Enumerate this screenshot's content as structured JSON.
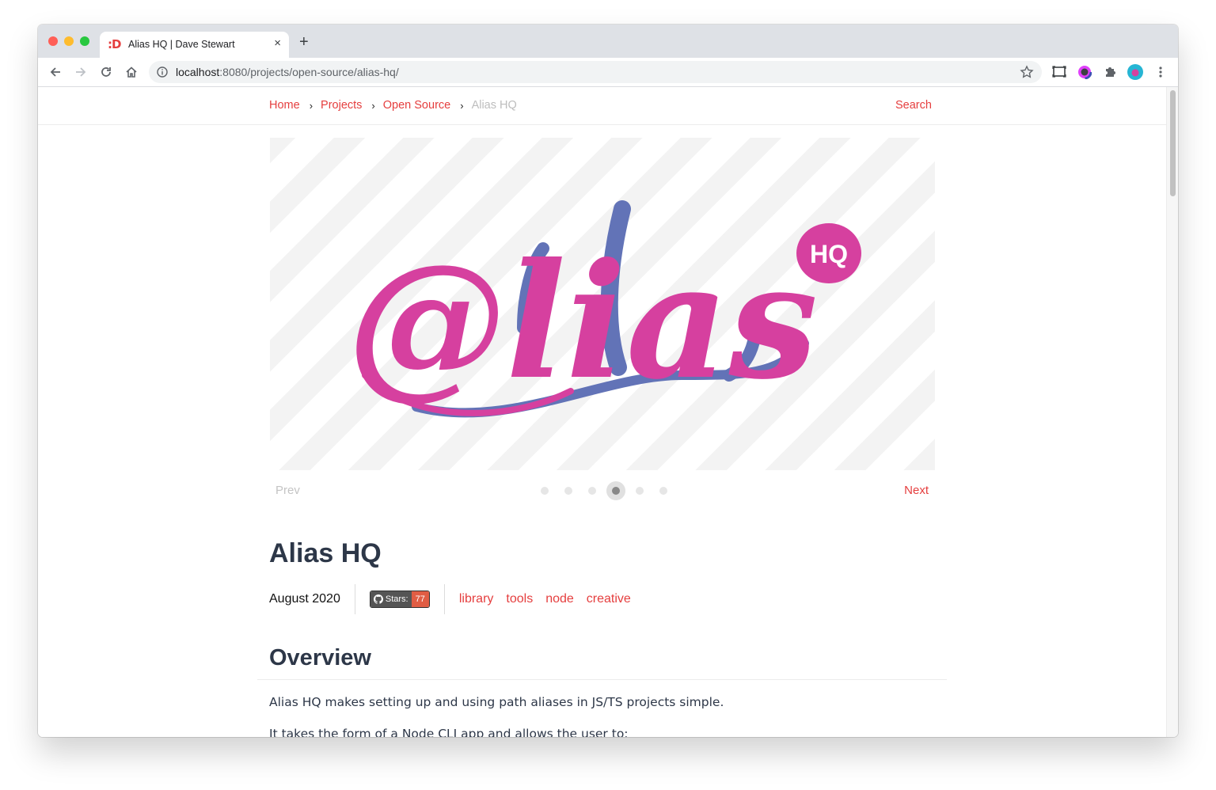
{
  "browser": {
    "tab": {
      "favicon": ":D",
      "title": "Alias HQ | Dave Stewart",
      "close": "×"
    },
    "new_tab": "+",
    "url": {
      "host": "localhost",
      "rest": ":8080/projects/open-source/alias-hq/"
    },
    "icons": [
      "back-arrow-icon",
      "forward-arrow-icon",
      "reload-icon",
      "home-icon",
      "info-icon",
      "star-icon",
      "cast-icon",
      "color-picker-extension-icon",
      "puzzle-extensions-icon",
      "profile-avatar-icon",
      "kebab-menu-icon"
    ]
  },
  "breadcrumbs": {
    "items": [
      "Home",
      "Projects",
      "Open Source"
    ],
    "current": "Alias HQ",
    "separator": "›"
  },
  "nav": {
    "search": "Search"
  },
  "hero": {
    "logo_main": "@lias",
    "logo_badge": "HQ",
    "colors": {
      "pink": "#d6409f",
      "blue": "#6273b7"
    }
  },
  "gallery": {
    "prev": "Prev",
    "next": "Next",
    "dot_count": 6,
    "active_index": 4
  },
  "project": {
    "title": "Alias HQ",
    "date": "August 2020",
    "github": {
      "label": "Stars:",
      "count": "77"
    },
    "tags": [
      "library",
      "tools",
      "node",
      "creative"
    ]
  },
  "overview": {
    "heading": "Overview",
    "para1": "Alias HQ makes setting up and using path aliases in JS/TS projects simple.",
    "para2": "It takes the form of a Node CLI app and allows the user to:"
  },
  "colors": {
    "accent": "#e53e3e",
    "heading": "#2d3748",
    "muted": "#bdbdbd"
  }
}
